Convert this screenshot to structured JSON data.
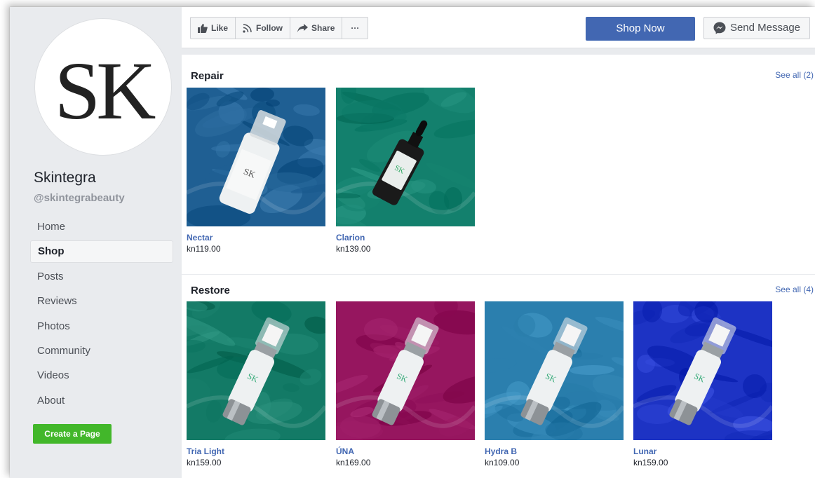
{
  "page": {
    "name": "Skintegra",
    "handle": "@skintegrabeauty",
    "avatar_text": "SK"
  },
  "nav": [
    "Home",
    "Shop",
    "Posts",
    "Reviews",
    "Photos",
    "Community",
    "Videos",
    "About"
  ],
  "create_page_label": "Create a Page",
  "actions": {
    "like": "Like",
    "follow": "Follow",
    "share": "Share",
    "more": "···",
    "shop_now": "Shop Now",
    "send_message": "Send Message"
  },
  "sections": [
    {
      "title": "Repair",
      "see_all": "See all (2)",
      "products": [
        {
          "name": "Nectar",
          "price": "kn119.00",
          "bg": "#1f5f93"
        },
        {
          "name": "Clarion",
          "price": "kn139.00",
          "bg": "#13806d"
        }
      ]
    },
    {
      "title": "Restore",
      "see_all": "See all (4)",
      "products": [
        {
          "name": "Tria Light",
          "price": "kn159.00",
          "bg": "#137a66"
        },
        {
          "name": "ÚNA",
          "price": "kn169.00",
          "bg": "#96165f"
        },
        {
          "name": "Hydra B",
          "price": "kn109.00",
          "bg": "#2b7fae"
        },
        {
          "name": "Lunar",
          "price": "kn159.00",
          "bg": "#1d33c4"
        }
      ]
    }
  ],
  "colors": {
    "link": "#4267b2",
    "green": "#42b72a",
    "page_bg": "#e9ebee"
  }
}
